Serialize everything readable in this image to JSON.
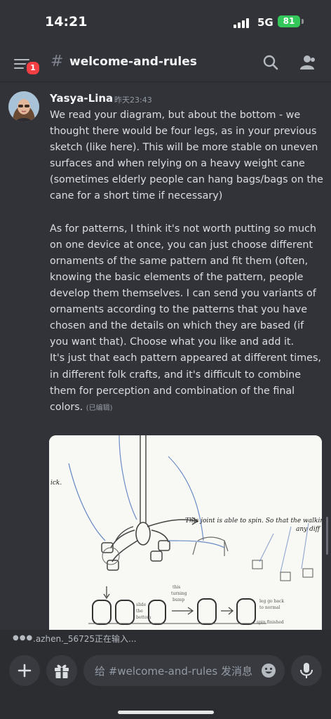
{
  "status_bar": {
    "time": "14:21",
    "network": "5G",
    "battery": "81"
  },
  "header": {
    "channel_name": "welcome-and-rules",
    "menu_badge": "1"
  },
  "message": {
    "author": "Yasya-Lina",
    "timestamp": "昨天23:43",
    "body": "We read your diagram, but about the bottom - we thought there would be four legs, as in your previous sketch (like here). This will be more stable on uneven surfaces and when relying on a heavy weight cane (sometimes elderly people can hang bags/bags on the cane for a short time if necessary)\n\nAs for patterns, I think it's not worth putting so much on one device at once, you can just choose different ornaments of the same pattern and fit them (often, knowing the basic elements of the pattern, people develop them themselves. I can send you variants of ornaments according to the patterns that you have chosen and the details on which they are based (if you want that). Choose what you like and add it.\nIt's just that each pattern appeared at different times, in different folk crafts, and it's difficult to combine them for perception and combination of the final colors.",
    "edited": "(已编辑)"
  },
  "sketch": {
    "joint_note_line1": "This joint is able to spin. So that the walking",
    "joint_note_line2": "any diff",
    "note_left": "ick.",
    "note_small_1": "slide",
    "note_small_2": "the",
    "note_small_3": "bottom",
    "note_small_4": "this",
    "note_small_5": "turning",
    "note_small_6": "bump",
    "note_small_7": "leg go back",
    "note_small_8": "to normal",
    "note_small_9": "spin finished"
  },
  "typing": {
    "text": ".azhen._56725正在输入..."
  },
  "composer": {
    "placeholder": "给 #welcome-and-rules 发消息"
  },
  "colors": {
    "background": "#323338",
    "badge": "#f23f43",
    "battery": "#34c759"
  }
}
